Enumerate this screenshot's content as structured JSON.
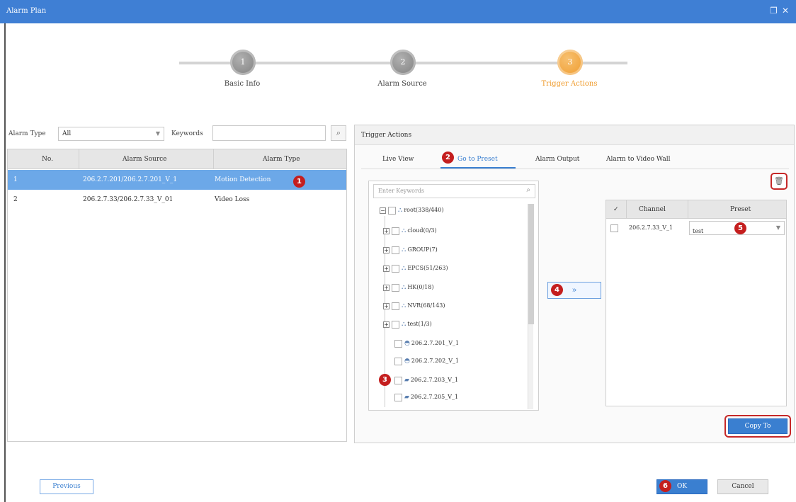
{
  "window": {
    "title": "Alarm Plan",
    "restore_icon": "restore-icon",
    "close_icon": "close-icon"
  },
  "steps": [
    {
      "number": "1",
      "label": "Basic Info",
      "state": "done"
    },
    {
      "number": "2",
      "label": "Alarm Source",
      "state": "done"
    },
    {
      "number": "3",
      "label": "Trigger Actions",
      "state": "active"
    }
  ],
  "filter": {
    "alarm_type_label": "Alarm Type",
    "alarm_type_value": "All",
    "keywords_label": "Keywords",
    "keywords_value": "",
    "search_icon": "search-icon"
  },
  "source_table": {
    "headers": [
      "No.",
      "Alarm Source",
      "Alarm Type"
    ],
    "rows": [
      {
        "no": "1",
        "source": "206.2.7.201/206.2.7.201_V_1",
        "type": "Motion Detection",
        "selected": true
      },
      {
        "no": "2",
        "source": "206.2.7.33/206.2.7.33_V_01",
        "type": "Video Loss",
        "selected": false
      }
    ]
  },
  "trigger": {
    "section_title": "Trigger Actions",
    "tabs": [
      "Live View",
      "Go to Preset",
      "Alarm Output",
      "Alarm to Video Wall"
    ],
    "active_tab": 1,
    "search_placeholder": "Enter Keywords",
    "tree": [
      {
        "label": "root(338/440)",
        "level": 0,
        "kind": "org"
      },
      {
        "label": "cloud(0/3)",
        "level": 1,
        "kind": "org"
      },
      {
        "label": "GROUP(7)",
        "level": 1,
        "kind": "org"
      },
      {
        "label": "EPCS(51/263)",
        "level": 1,
        "kind": "org"
      },
      {
        "label": "HK(0/18)",
        "level": 1,
        "kind": "org"
      },
      {
        "label": "NVR(68/143)",
        "level": 1,
        "kind": "org"
      },
      {
        "label": "test(1/3)",
        "level": 1,
        "kind": "org"
      },
      {
        "label": "206.2.7.201_V_1",
        "level": 2,
        "kind": "camera-dome"
      },
      {
        "label": "206.2.7.202_V_1",
        "level": 2,
        "kind": "camera-dome"
      },
      {
        "label": "206.2.7.203_V_1",
        "level": 2,
        "kind": "camera-box"
      },
      {
        "label": "206.2.7.205_V_1",
        "level": 2,
        "kind": "camera-box"
      }
    ],
    "move_button": "»",
    "delete_icon": "trash-icon",
    "dest_headers": [
      "",
      "Channel",
      "Preset"
    ],
    "dest_rows": [
      {
        "channel": "206.2.7.33_V_1",
        "preset": "test"
      }
    ],
    "copy_to": "Copy To"
  },
  "footer": {
    "previous": "Previous",
    "ok": "OK",
    "cancel": "Cancel"
  },
  "callouts": [
    "1",
    "2",
    "3",
    "4",
    "5",
    "6"
  ],
  "colors": {
    "titlebar": "#3f7fd4",
    "accent": "#3a7fd0",
    "step_active": "#ef9b2c",
    "callout": "#c41e1e"
  }
}
